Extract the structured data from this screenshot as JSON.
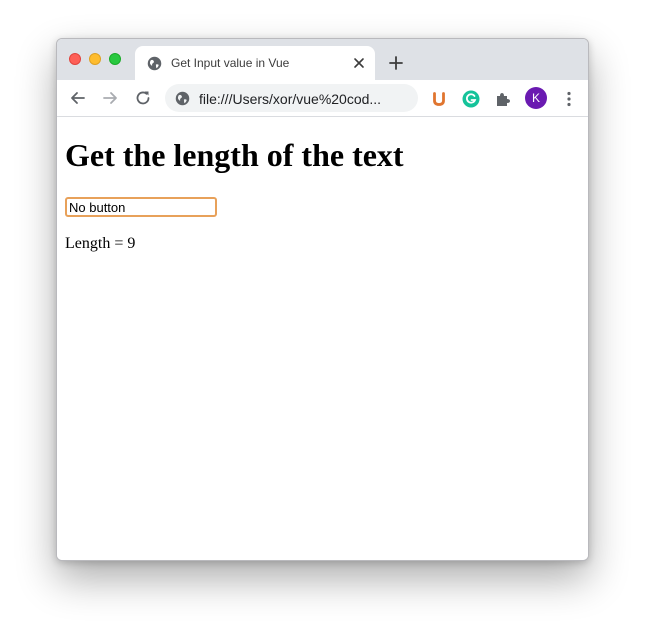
{
  "browser": {
    "tab": {
      "title": "Get Input value in Vue"
    },
    "address_bar": {
      "url": "file:///Users/xor/vue%20cod..."
    },
    "profile_initial": "K",
    "colors": {
      "tabstrip": "#dee1e6",
      "avatar": "#6a1ab1",
      "input_focus_border": "#e8a15a"
    }
  },
  "page": {
    "heading": "Get the length of the text",
    "input": {
      "value": "No button"
    },
    "length": {
      "label": "Length = ",
      "value": "9"
    }
  }
}
